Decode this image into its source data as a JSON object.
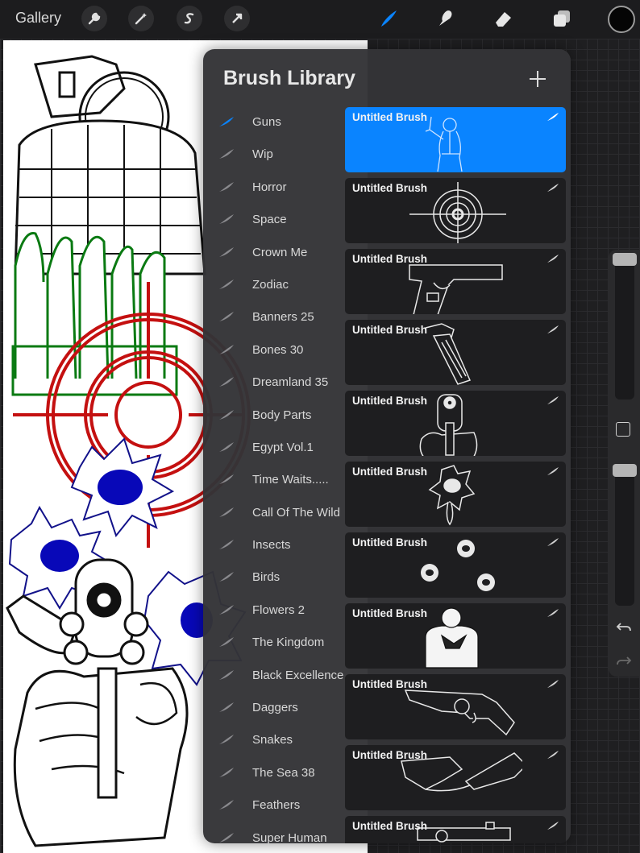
{
  "toolbar": {
    "gallery_label": "Gallery",
    "left_tools": [
      "wrench-icon",
      "magic-wand-icon",
      "selection-s-icon",
      "transform-arrow-icon"
    ],
    "right_tools": [
      "brush-icon",
      "smudge-icon",
      "eraser-icon",
      "layers-icon"
    ],
    "active_tool": "brush-icon",
    "active_color": "#0a84ff",
    "current_color": "#050505"
  },
  "brush_library": {
    "title": "Brush Library",
    "sets": [
      "Guns",
      "Wip",
      "Horror",
      "Space",
      "Crown Me",
      "Zodiac",
      "Banners 25",
      "Bones 30",
      "Dreamland 35",
      "Body Parts",
      "Egypt Vol.1",
      "Time Waits.....",
      "Call Of The Wild",
      "Insects",
      "Birds",
      "Flowers 2",
      "The Kingdom",
      "Black Excellence",
      "Daggers",
      "Snakes",
      "The Sea 38",
      "Feathers",
      "Super Human"
    ],
    "selected_set": "Guns",
    "brushes": [
      {
        "name": "Untitled Brush",
        "art": "woman-with-gun"
      },
      {
        "name": "Untitled Brush",
        "art": "crosshair-target"
      },
      {
        "name": "Untitled Brush",
        "art": "pistol"
      },
      {
        "name": "Untitled Brush",
        "art": "magazine"
      },
      {
        "name": "Untitled Brush",
        "art": "hand-holding-revolver"
      },
      {
        "name": "Untitled Brush",
        "art": "bullet-hole-drip"
      },
      {
        "name": "Untitled Brush",
        "art": "bullet-holes"
      },
      {
        "name": "Untitled Brush",
        "art": "man-aiming-gun"
      },
      {
        "name": "Untitled Brush",
        "art": "revolver"
      },
      {
        "name": "Untitled Brush",
        "art": "hands-with-guns"
      },
      {
        "name": "Untitled Brush",
        "art": "revolver-partial"
      }
    ],
    "selected_brush_index": 0
  },
  "sidebar": {
    "brush_size_level": 0.95,
    "opacity_level": 0.95,
    "icons": [
      "modify-square-icon",
      "undo-icon",
      "redo-icon"
    ]
  },
  "canvas_art": [
    "grenade",
    "bullets-green",
    "crosshair-red",
    "bullet-holes-blue",
    "revolver-in-fist",
    "bullet-cartridge"
  ]
}
